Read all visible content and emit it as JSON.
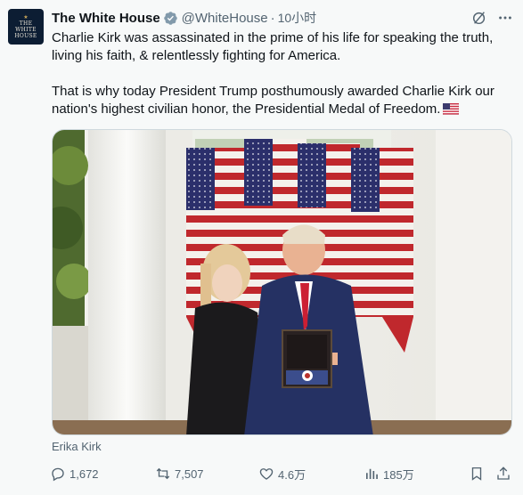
{
  "tweet": {
    "account": {
      "avatar_text_line1": "THE",
      "avatar_text_line2": "WHITE",
      "avatar_text_line3": "HOUSE",
      "display_name": "The White House",
      "verified_badge": "gray-check-badge",
      "handle": "@WhiteHouse",
      "separator": "·",
      "timestamp": "10小时"
    },
    "text": {
      "paragraph1": "Charlie Kirk was assassinated in the prime of his life for speaking the truth, living his faith, & relentlessly fighting for America.",
      "paragraph2": "That is why today President Trump posthumously awarded Charlie Kirk our nation's highest civilian honor, the Presidential Medal of Freedom."
    },
    "media": {
      "type": "photo",
      "caption": "Erika Kirk"
    },
    "actions": {
      "reply_count": "1,672",
      "retweet_count": "7,507",
      "like_count": "4.6万",
      "view_count": "185万"
    },
    "icons": [
      "grok-icon",
      "more-icon",
      "reply-icon",
      "retweet-icon",
      "like-icon",
      "views-icon",
      "bookmark-icon",
      "share-icon",
      "us-flag-emoji"
    ],
    "colors": {
      "text_primary": "#0f1419",
      "text_secondary": "#536471",
      "background": "#f7f9f9",
      "border": "#cfd9de",
      "verified_badge": "#829aab"
    }
  }
}
